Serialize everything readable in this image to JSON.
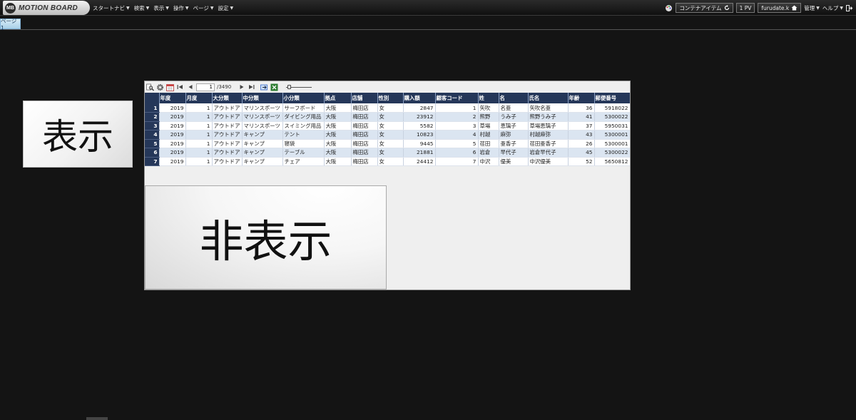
{
  "app": {
    "logo_mark": "MB",
    "logo_text": "MOTION BOARD"
  },
  "menu": [
    {
      "label": "スタートナビ"
    },
    {
      "label": "検索"
    },
    {
      "label": "表示"
    },
    {
      "label": "操作"
    },
    {
      "label": "ページ"
    },
    {
      "label": "設定"
    }
  ],
  "right_tools": {
    "container_item": "コンテナアイテム",
    "pv": "1 PV",
    "user": "furudate.k",
    "manage": "管理",
    "help": "ヘルプ"
  },
  "page_tab": "ページ1",
  "buttons": {
    "show": "表示",
    "hide": "非表示"
  },
  "grid": {
    "current_page": "1",
    "total_pages": "/3490",
    "columns": [
      "年度",
      "月度",
      "大分類",
      "中分類",
      "小分類",
      "拠点",
      "店舗",
      "性別",
      "購入額",
      "顧客コード",
      "姓",
      "名",
      "氏名",
      "年齢",
      "郵便番号"
    ],
    "rows": [
      [
        "1",
        "2019",
        "1",
        "アウトドア",
        "マリンスポーツ",
        "サーフボード",
        "大阪",
        "梅田店",
        "女",
        "2847",
        "1",
        "矢吹",
        "名亜",
        "矢吹名亜",
        "36",
        "5918022"
      ],
      [
        "2",
        "2019",
        "1",
        "アウトドア",
        "マリンスポーツ",
        "ダイビング用品",
        "大阪",
        "梅田店",
        "女",
        "23912",
        "2",
        "熊野",
        "うみ子",
        "熊野うみ子",
        "41",
        "5300022"
      ],
      [
        "3",
        "2019",
        "1",
        "アウトドア",
        "マリンスポーツ",
        "スイミング用品",
        "大阪",
        "梅田店",
        "女",
        "5582",
        "3",
        "草場",
        "恵璃子",
        "草場恵璃子",
        "37",
        "5950031"
      ],
      [
        "4",
        "2019",
        "1",
        "アウトドア",
        "キャンプ",
        "テント",
        "大阪",
        "梅田店",
        "女",
        "10823",
        "4",
        "村越",
        "麻弥",
        "村越麻弥",
        "43",
        "5300001"
      ],
      [
        "5",
        "2019",
        "1",
        "アウトドア",
        "キャンプ",
        "寝袋",
        "大阪",
        "梅田店",
        "女",
        "9445",
        "5",
        "荏田",
        "亜香子",
        "荏田亜香子",
        "26",
        "5300001"
      ],
      [
        "6",
        "2019",
        "1",
        "アウトドア",
        "キャンプ",
        "テーブル",
        "大阪",
        "梅田店",
        "女",
        "21881",
        "6",
        "岩倉",
        "早代子",
        "岩倉早代子",
        "45",
        "5300022"
      ],
      [
        "7",
        "2019",
        "1",
        "アウトドア",
        "キャンプ",
        "チェア",
        "大阪",
        "梅田店",
        "女",
        "24412",
        "7",
        "中沢",
        "優美",
        "中沢優美",
        "52",
        "5650812"
      ]
    ]
  },
  "colors": {
    "header_bg": "#253759",
    "row_alt": "#dbe5f1",
    "background": "#141414"
  }
}
